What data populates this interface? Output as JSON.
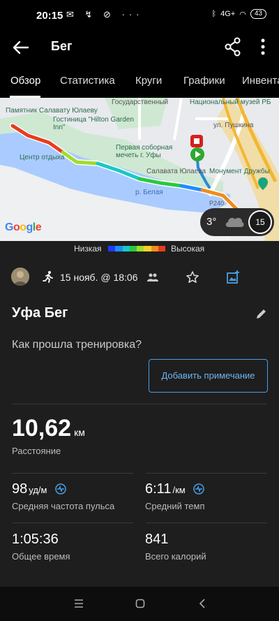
{
  "status_bar": {
    "time": "20:15",
    "left_icons": "✉ ↯ ⊘ ···",
    "network": "4G+",
    "battery": "43"
  },
  "app_bar": {
    "title": "Бег"
  },
  "tabs": [
    {
      "label": "Обзор",
      "active": true
    },
    {
      "label": "Статистика",
      "active": false
    },
    {
      "label": "Круги",
      "active": false
    },
    {
      "label": "Графики",
      "active": false
    },
    {
      "label": "Инвента",
      "active": false
    }
  ],
  "map": {
    "labels": {
      "monument_julaev": "Памятник Салавату Юлаеву",
      "hotel": "Гостиница \"Hilton Garden Inn\"",
      "center": "Центр отдыха",
      "mosque": "Первая соборная мечеть г. Уфы",
      "salavat": "Салавата Юлаева",
      "river": "р. Белая",
      "friendship": "Монумент Дружбы",
      "state": "Государственный",
      "museum": "Национальный музей РБ",
      "pushkin": "ул. Пушкина",
      "road": "P240"
    },
    "provider": "Google",
    "weather": {
      "temperature": "3°",
      "condition_icon": "cloud-icon",
      "wind_speed": "15"
    }
  },
  "legend": {
    "low": "Низкая",
    "high": "Высокая",
    "colors": [
      "#1e3cff",
      "#1e8cff",
      "#19c8c8",
      "#2ac840",
      "#a0dc28",
      "#f0d228",
      "#f08c1e",
      "#e83c1e"
    ]
  },
  "activity": {
    "type_icon": "run-icon",
    "date": "15 нояб. @ 18:06",
    "title": "Уфа Бег",
    "question": "Как прошла тренировка?",
    "add_note": "Добавить примечание",
    "distance": {
      "value": "10,62",
      "unit": "км",
      "label": "Расстояние"
    },
    "heart_rate": {
      "value": "98",
      "unit": "уд/м",
      "label": "Средняя частота пульса"
    },
    "pace": {
      "value": "6:11",
      "unit": "/км",
      "label": "Средний темп"
    },
    "total_time": {
      "value": "1:05:36",
      "label": "Общее время"
    },
    "calories": {
      "value": "841",
      "label": "Всего калорий"
    }
  },
  "colors": {
    "background": "#1e1e1e",
    "accent": "#4a9ee6",
    "route_start": "#2ea82e",
    "route_finish": "#d81e1e"
  }
}
